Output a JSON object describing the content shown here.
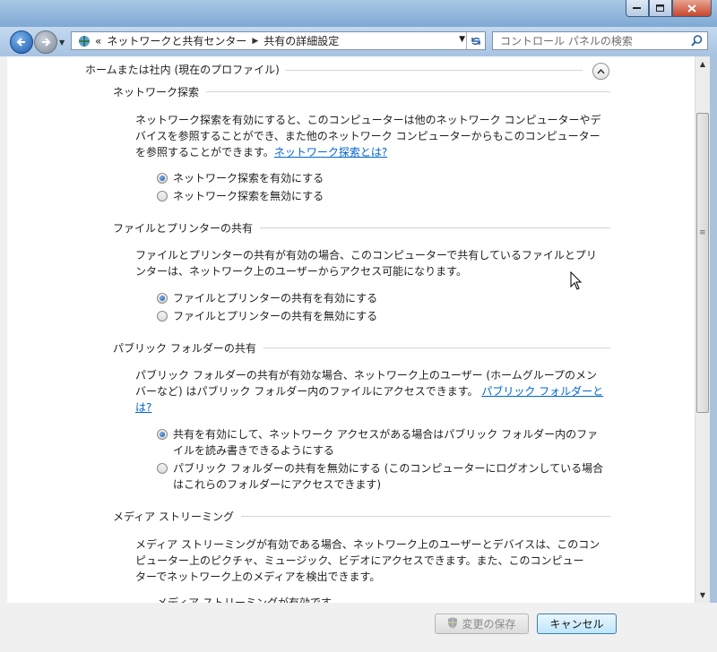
{
  "window": {
    "min_icon": "minimize-icon",
    "max_icon": "maximize-icon",
    "close_icon": "close-icon"
  },
  "nav": {
    "breadcrumb_prefix": "«",
    "crumbs": [
      "ネットワークと共有センター",
      "共有の詳細設定"
    ],
    "search_placeholder": "コントロール パネルの検索"
  },
  "profile": {
    "title": "ホームまたは社内 (現在のプロファイル)"
  },
  "sections": [
    {
      "title": "ネットワーク探索",
      "desc_lines": [
        "ネットワーク探索を有効にすると、このコンピューターは他のネットワーク コンピューターやデ",
        "バイスを参照することができ、また他のネットワーク コンピューターからもこのコンピューター",
        "を参照することができます。"
      ],
      "link": "ネットワーク探索とは?",
      "options": [
        "ネットワーク探索を有効にする",
        "ネットワーク探索を無効にする"
      ],
      "selected": 0
    },
    {
      "title": "ファイルとプリンターの共有",
      "desc_lines": [
        "ファイルとプリンターの共有が有効の場合、このコンピューターで共有しているファイルとプリ",
        "ンターは、ネットワーク上のユーザーからアクセス可能になります。"
      ],
      "options": [
        "ファイルとプリンターの共有を有効にする",
        "ファイルとプリンターの共有を無効にする"
      ],
      "selected": 0
    },
    {
      "title": "パブリック フォルダーの共有",
      "desc_lines": [
        "パブリック フォルダーの共有が有効な場合、ネットワーク上のユーザー (ホームグループのメン",
        "バーなど) はパブリック フォルダー内のファイルにアクセスできます。"
      ],
      "link_line1": "パブリック フォルダーと",
      "link_line2": "は?",
      "options": [
        [
          "共有を有効にして、ネットワーク アクセスがある場合はパブリック フォルダー内のファ",
          "イルを読み書きできるようにする"
        ],
        [
          "パブリック フォルダーの共有を無効にする (このコンピューターにログオンしている場合",
          "はこれらのフォルダーにアクセスできます)"
        ]
      ],
      "selected": 0
    },
    {
      "title": "メディア ストリーミング",
      "desc_lines": [
        "メディア ストリーミングが有効である場合、ネットワーク上のユーザーとデバイスは、このコン",
        "ピューター上のピクチャ、ミュージック、ビデオにアクセスできます。また、このコンピュー",
        "ターでネットワーク上のメディアを検出できます。"
      ],
      "status_partial": "メディア ストリーミングが有効です。"
    }
  ],
  "buttons": {
    "save": "変更の保存",
    "cancel": "キャンセル"
  }
}
